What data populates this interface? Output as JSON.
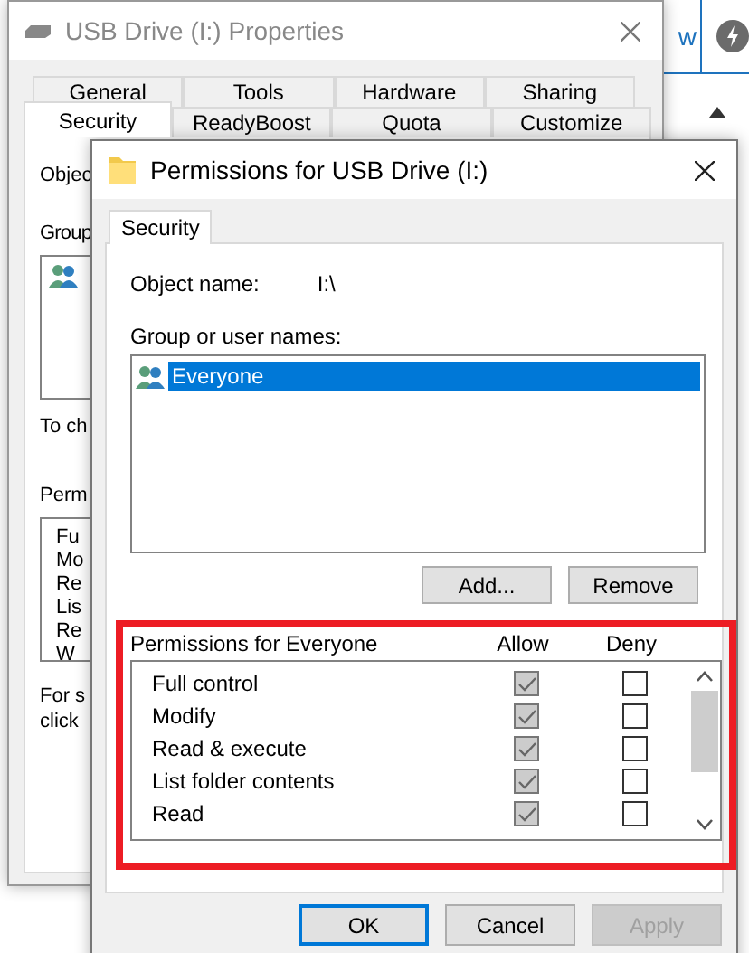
{
  "background_app": {
    "button_text": "w"
  },
  "properties_window": {
    "title": "USB Drive (I:) Properties",
    "tab_rows": [
      [
        {
          "label": "General",
          "selected": false
        },
        {
          "label": "Tools",
          "selected": false
        },
        {
          "label": "Hardware",
          "selected": false
        },
        {
          "label": "Sharing",
          "selected": false
        }
      ],
      [
        {
          "label": "Security",
          "selected": true
        },
        {
          "label": "ReadyBoost",
          "selected": false
        },
        {
          "label": "Quota",
          "selected": false
        },
        {
          "label": "Customize",
          "selected": false
        }
      ]
    ],
    "object_label": "Objec",
    "group_label": "Group",
    "note": "To ch",
    "permissions_label": "Perm",
    "permissions": [
      "Fu",
      "Mo",
      "Re",
      "Lis",
      "Re",
      "W"
    ],
    "footer": [
      "For s",
      "click"
    ]
  },
  "permissions_dialog": {
    "title": "Permissions for USB Drive (I:)",
    "tabs": [
      {
        "label": "Security",
        "selected": true
      }
    ],
    "object_name_label": "Object name:",
    "object_name": "I:\\",
    "group_label": "Group or user names:",
    "groups": [
      {
        "name": "Everyone",
        "selected": true
      }
    ],
    "group_buttons": [
      "Add...",
      "Remove"
    ],
    "permissions_label": "Permissions for Everyone",
    "columns": [
      "Allow",
      "Deny"
    ],
    "permissions": [
      {
        "name": "Full control",
        "allow": true,
        "deny": false
      },
      {
        "name": "Modify",
        "allow": true,
        "deny": false
      },
      {
        "name": "Read & execute",
        "allow": true,
        "deny": false
      },
      {
        "name": "List folder contents",
        "allow": true,
        "deny": false
      },
      {
        "name": "Read",
        "allow": true,
        "deny": false
      }
    ],
    "buttons": [
      {
        "label": "OK",
        "default": true,
        "disabled": false
      },
      {
        "label": "Cancel",
        "default": false,
        "disabled": false
      },
      {
        "label": "Apply",
        "default": false,
        "disabled": true
      }
    ]
  }
}
